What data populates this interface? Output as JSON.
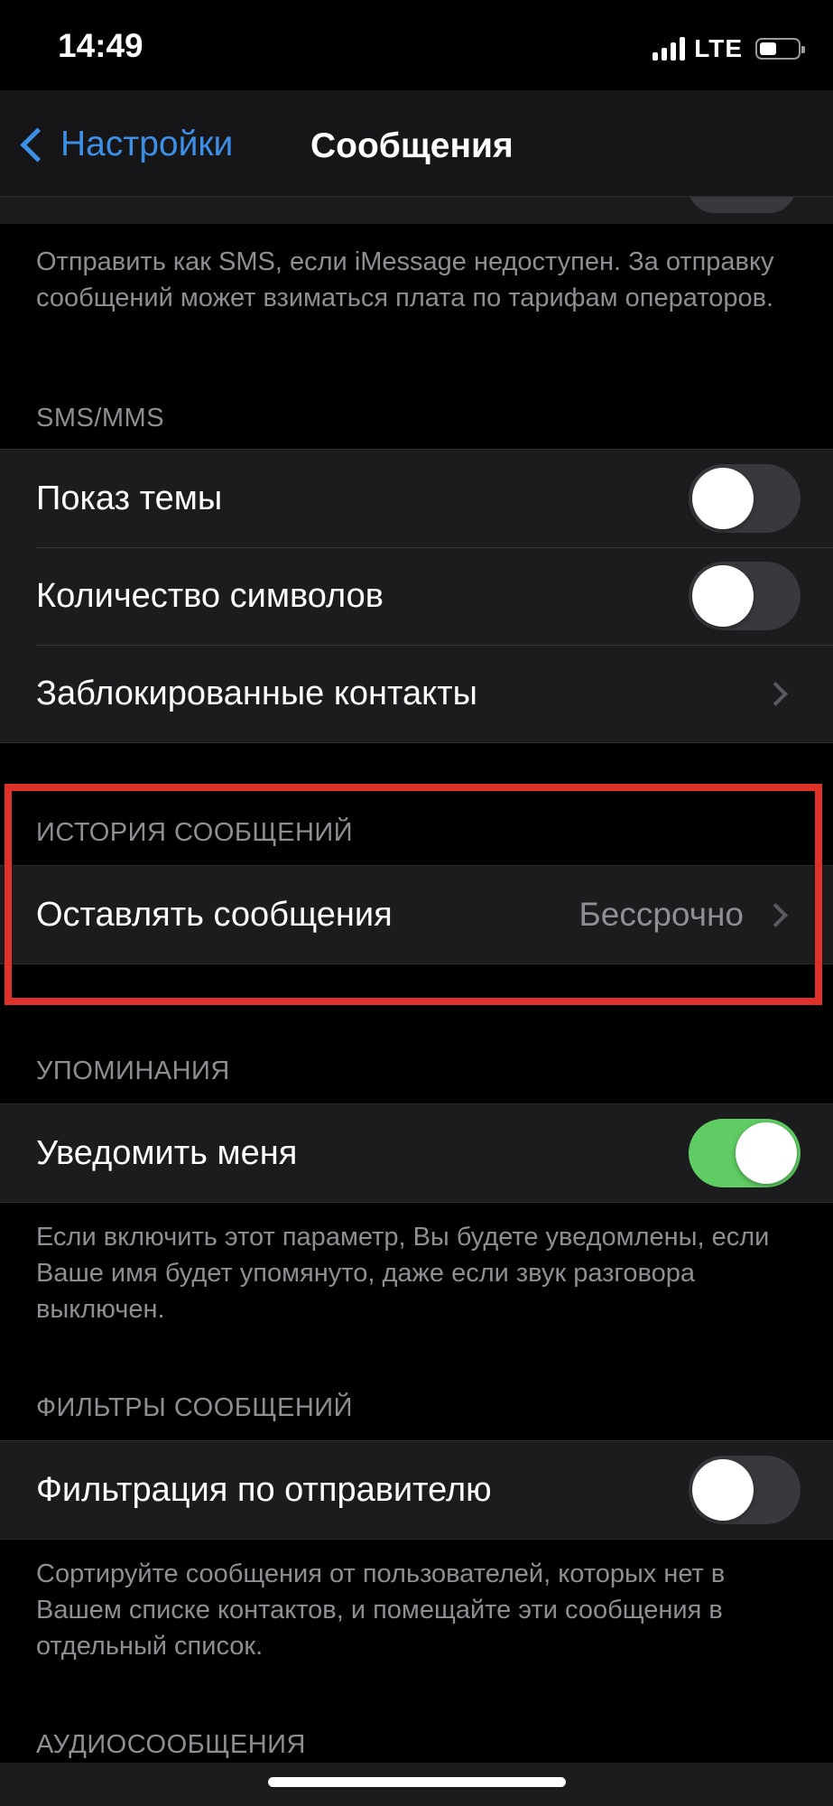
{
  "status_bar": {
    "time": "14:49",
    "network": "LTE"
  },
  "nav": {
    "back_label": "Настройки",
    "title": "Сообщения"
  },
  "sms_fallback_footer": "Отправить как SMS, если iMessage недоступен. За отправку сообщений может взиматься плата по тарифам операторов.",
  "sms_mms": {
    "header": "SMS/MMS",
    "rows": [
      {
        "label": "Показ темы",
        "toggle_on": false
      },
      {
        "label": "Количество символов",
        "toggle_on": false
      },
      {
        "label": "Заблокированные контакты"
      }
    ]
  },
  "history": {
    "header": "ИСТОРИЯ СООБЩЕНИЙ",
    "keep_label": "Оставлять сообщения",
    "keep_value": "Бессрочно"
  },
  "mentions": {
    "header": "УПОМИНАНИЯ",
    "notify_label": "Уведомить меня",
    "notify_on": true,
    "footer": "Если включить этот параметр, Вы будете уведомлены, если Ваше имя будет упомянуто, даже если звук разговора выключен."
  },
  "filters": {
    "header": "ФИЛЬТРЫ СООБЩЕНИЙ",
    "filter_label": "Фильтрация по отправителю",
    "filter_on": false,
    "footer": "Сортируйте сообщения от пользователей, которых нет в Вашем списке контактов, и помещайте эти сообщения в отдельный список."
  },
  "audio": {
    "header": "АУДИОСООБЩЕНИЯ"
  },
  "colors": {
    "accent_blue": "#3d8fe6",
    "toggle_on_green": "#5fcd63",
    "highlight_red": "#e0302a",
    "cell_bg": "#1c1c1e"
  }
}
